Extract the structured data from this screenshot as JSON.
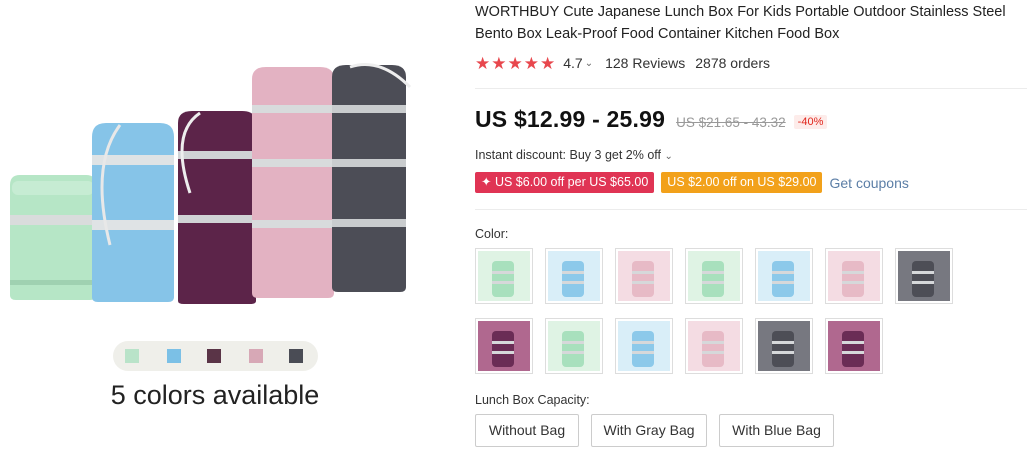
{
  "hero": {
    "colors_caption": "5 colors available",
    "swatch_colors": [
      "#b9e3c9",
      "#7bc0e6",
      "#5a3447",
      "#d7a8b6",
      "#4a4c55"
    ]
  },
  "product": {
    "title": "WORTHBUY Cute Japanese Lunch Box For Kids Portable Outdoor Stainless Steel Bento Box Leak-Proof Food Container Kitchen Food Box",
    "rating": "4.7",
    "reviews": "128 Reviews",
    "orders": "2878 orders"
  },
  "pricing": {
    "price": "US $12.99 - 25.99",
    "original_price": "US $21.65 - 43.32",
    "discount": "-40%"
  },
  "promotions": {
    "instant_discount": "Instant discount: Buy 3 get 2% off",
    "coupon_1": "✦ US $6.00 off per US $65.00",
    "coupon_2": "US $2.00 off on US $29.00",
    "get_coupons": "Get coupons"
  },
  "color_section": {
    "label": "Color:",
    "options": [
      {
        "name": "green",
        "body": "#a8e0bd",
        "bg": "#dff3e4"
      },
      {
        "name": "blue",
        "body": "#8cc9ea",
        "bg": "#d9eef8"
      },
      {
        "name": "pink",
        "body": "#e7bac6",
        "bg": "#f4dce3"
      },
      {
        "name": "green-stack",
        "body": "#a8e0bd",
        "bg": "#dff3e4"
      },
      {
        "name": "blue-stack",
        "body": "#8cc9ea",
        "bg": "#d9eef8"
      },
      {
        "name": "pink-stack",
        "body": "#e7bac6",
        "bg": "#f4dce3"
      },
      {
        "name": "gray",
        "body": "#4d4e56",
        "bg": "#777880"
      },
      {
        "name": "purple",
        "body": "#6a2c55",
        "bg": "#b0688f"
      },
      {
        "name": "green-tall",
        "body": "#a8e0bd",
        "bg": "#dff3e4"
      },
      {
        "name": "blue-tall",
        "body": "#8cc9ea",
        "bg": "#d9eef8"
      },
      {
        "name": "pink-tall",
        "body": "#e7bac6",
        "bg": "#f4dce3"
      },
      {
        "name": "gray-tall",
        "body": "#4d4e56",
        "bg": "#777880"
      },
      {
        "name": "purple-tall",
        "body": "#6a2c55",
        "bg": "#b0688f"
      }
    ]
  },
  "capacity_section": {
    "label": "Lunch Box Capacity:",
    "options": [
      "Without Bag",
      "With Gray Bag",
      "With Blue Bag"
    ]
  },
  "colors": {
    "star": "#e8474d",
    "coupon_red": "#e03454",
    "coupon_orange": "#f2a11a",
    "link": "#5b7ea6"
  }
}
